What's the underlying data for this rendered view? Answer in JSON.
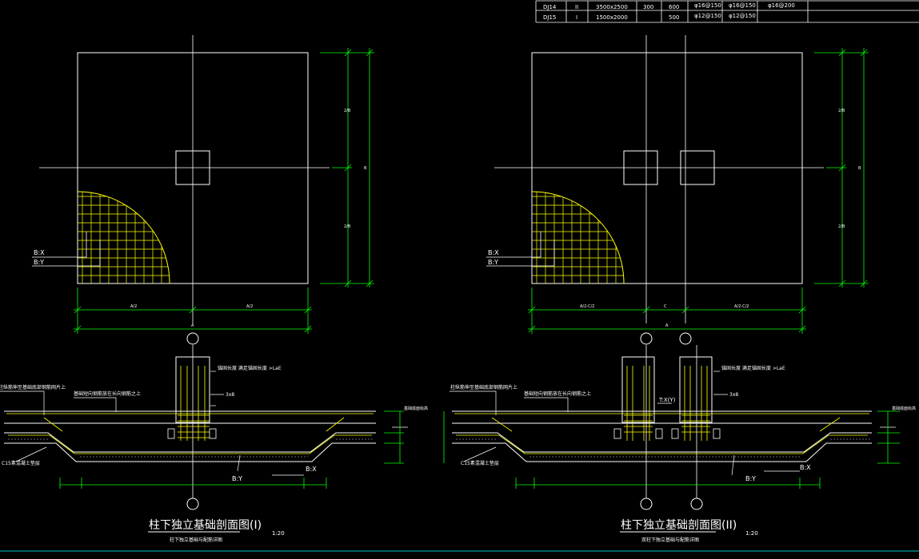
{
  "table": {
    "rows": [
      [
        "DJ14",
        "II",
        "3500x2500",
        "300",
        "600",
        "φ16@150",
        "φ16@150",
        "φ16@200"
      ],
      [
        "DJ15",
        "I",
        "1500x2000",
        "",
        "500",
        "φ12@150",
        "φ12@150",
        ""
      ]
    ]
  },
  "left": {
    "dims_plan_right": [
      "2/B",
      "B",
      "2/B"
    ],
    "dims_plan_bottom": [
      "A/2",
      "A/2",
      "A"
    ],
    "label_bx": "B:X",
    "label_by": "B:Y",
    "section_notes": [
      "柱纵筋伸至基础底部钢筋网片上",
      "基础短向钢筋放在长向钢筋之上",
      "锚固长度 满足锚固长度 >LaE",
      "3x8",
      "C15素混凝土垫层",
      "基础底面标高"
    ],
    "section_labels_bottom": [
      "B:Y",
      "B:X"
    ],
    "title": "柱下独立基础剖面图(I)",
    "scale": "1:20",
    "subtitle": "柱下独立基础与配筋详图"
  },
  "right": {
    "dims_plan_right": [
      "2/B",
      "B",
      "2/B"
    ],
    "dims_plan_bottom": [
      "A/2-C/2",
      "C",
      "A/2-C/2",
      "A"
    ],
    "label_bx": "B:X",
    "label_by": "B:Y",
    "section_notes": [
      "柱纵筋伸至基础底部钢筋网片上",
      "基础短向钢筋放在长向钢筋之上",
      "锚固长度 满足锚固长度 >LaE",
      "3x8",
      "T:X(Y)",
      "C15素混凝土垫层",
      "基础底面标高"
    ],
    "section_labels_bottom": [
      "B:Y",
      "B:X"
    ],
    "title": "柱下独立基础剖面图(II)",
    "scale": "1:20",
    "subtitle": "双柱下独立基础与配筋详图"
  },
  "colors": {
    "white": "#ffffff",
    "green": "#00ff00",
    "yellow": "#ffff00",
    "cyan": "#00c8c8",
    "background": "#000000"
  }
}
